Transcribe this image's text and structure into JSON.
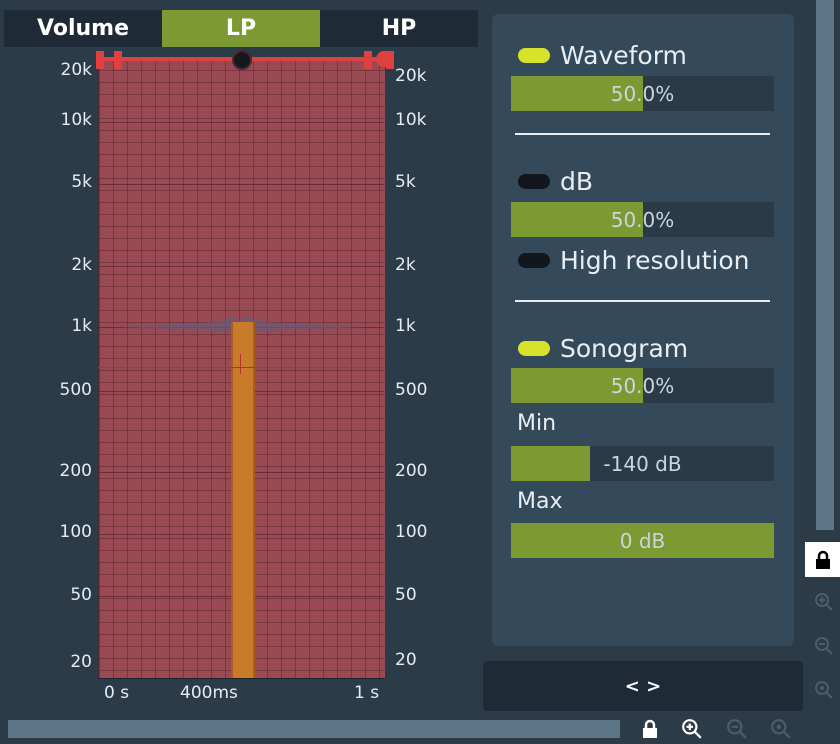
{
  "tabs": [
    "Volume",
    "LP",
    "HP"
  ],
  "y_axis": [
    "20k",
    "10k",
    "5k",
    "2k",
    "1k",
    "500",
    "200",
    "100",
    "50",
    "20"
  ],
  "x_axis": [
    "0 s",
    "400ms",
    "1 s"
  ],
  "panel": {
    "waveform": {
      "label": "Waveform",
      "on": true,
      "value": "50.0%",
      "level": 0.5
    },
    "db": {
      "label": "dB",
      "on": false,
      "value": "50.0%",
      "level": 0.5
    },
    "high_resolution": {
      "label": "High resolution",
      "on": false
    },
    "sonogram": {
      "label": "Sonogram",
      "on": true,
      "value": "50.0%",
      "level": 0.5
    },
    "min": {
      "label": "Min",
      "value": "-140 dB",
      "level": 0.3
    },
    "max": {
      "label": "Max",
      "value": "0 dB",
      "level": 1.0
    }
  },
  "bottom_button": "< >",
  "colors": {
    "accent": "#7c9a31",
    "toggle_on": "#d7e32a",
    "plot": "#9a4a52",
    "lp_line": "#e04040"
  }
}
